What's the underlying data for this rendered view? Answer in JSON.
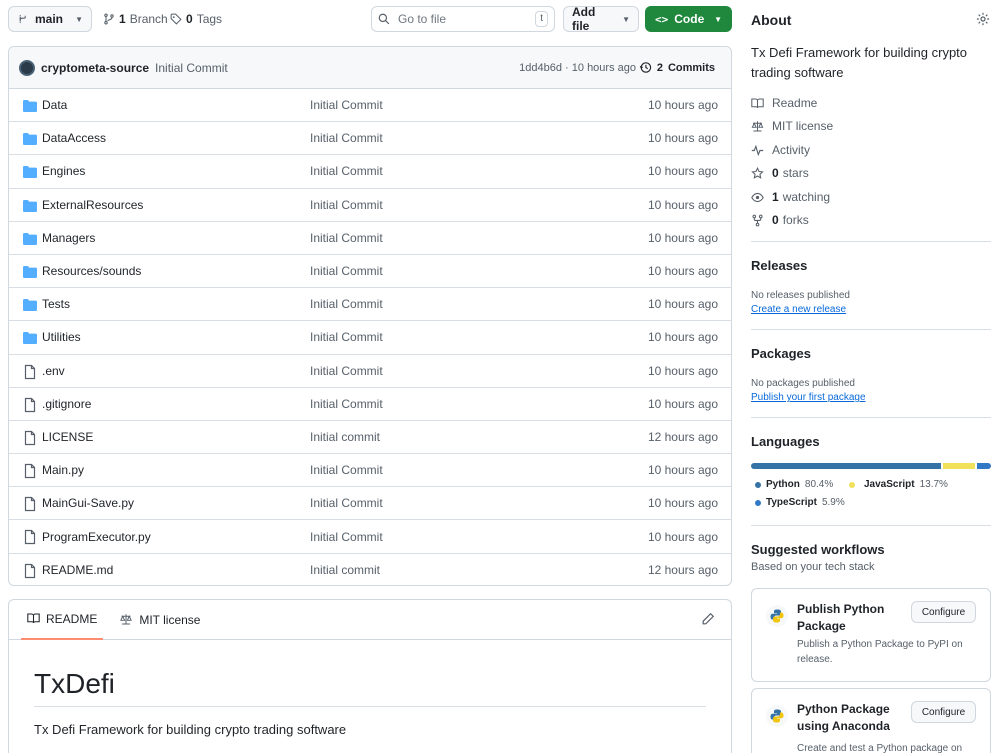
{
  "toolbar": {
    "branch": "main",
    "branches_count": "1",
    "branches_label": "Branch",
    "tags_count": "0",
    "tags_label": "Tags",
    "goto_placeholder": "Go to file",
    "goto_shortcut": "t",
    "add_file_label": "Add file",
    "code_label": "Code"
  },
  "commit": {
    "author": "cryptometa-source",
    "message": "Initial Commit",
    "hash_age": "1dd4b6d · 10 hours ago",
    "commits_count": "2",
    "commits_label": "Commits"
  },
  "files": [
    {
      "type": "dir",
      "name": "Data",
      "message": "Initial Commit",
      "age": "10 hours ago"
    },
    {
      "type": "dir",
      "name": "DataAccess",
      "message": "Initial Commit",
      "age": "10 hours ago"
    },
    {
      "type": "dir",
      "name": "Engines",
      "message": "Initial Commit",
      "age": "10 hours ago"
    },
    {
      "type": "dir",
      "name": "ExternalResources",
      "message": "Initial Commit",
      "age": "10 hours ago"
    },
    {
      "type": "dir",
      "name": "Managers",
      "message": "Initial Commit",
      "age": "10 hours ago"
    },
    {
      "type": "dir",
      "name": "Resources/sounds",
      "message": "Initial Commit",
      "age": "10 hours ago"
    },
    {
      "type": "dir",
      "name": "Tests",
      "message": "Initial Commit",
      "age": "10 hours ago"
    },
    {
      "type": "dir",
      "name": "Utilities",
      "message": "Initial Commit",
      "age": "10 hours ago"
    },
    {
      "type": "file",
      "name": ".env",
      "message": "Initial Commit",
      "age": "10 hours ago"
    },
    {
      "type": "file",
      "name": ".gitignore",
      "message": "Initial Commit",
      "age": "10 hours ago"
    },
    {
      "type": "file",
      "name": "LICENSE",
      "message": "Initial commit",
      "age": "12 hours ago"
    },
    {
      "type": "file",
      "name": "Main.py",
      "message": "Initial Commit",
      "age": "10 hours ago"
    },
    {
      "type": "file",
      "name": "MainGui-Save.py",
      "message": "Initial Commit",
      "age": "10 hours ago"
    },
    {
      "type": "file",
      "name": "ProgramExecutor.py",
      "message": "Initial Commit",
      "age": "10 hours ago"
    },
    {
      "type": "file",
      "name": "README.md",
      "message": "Initial commit",
      "age": "12 hours ago"
    }
  ],
  "readme": {
    "tab_readme": "README",
    "tab_license": "MIT license",
    "title": "TxDefi",
    "description": "Tx Defi Framework for building crypto trading software"
  },
  "about": {
    "heading": "About",
    "description": "Tx Defi Framework for building crypto trading software",
    "readme": "Readme",
    "license": "MIT license",
    "activity": "Activity",
    "stars_count": "0",
    "stars_label": "stars",
    "watching_count": "1",
    "watching_label": "watching",
    "forks_count": "0",
    "forks_label": "forks"
  },
  "releases": {
    "heading": "Releases",
    "none": "No releases published",
    "create_link": "Create a new release"
  },
  "packages": {
    "heading": "Packages",
    "none": "No packages published",
    "publish_link": "Publish your first package"
  },
  "languages": {
    "heading": "Languages",
    "items": [
      {
        "name": "Python",
        "percent": "80.4%",
        "value": 80.4,
        "color": "#3572A5"
      },
      {
        "name": "JavaScript",
        "percent": "13.7%",
        "value": 13.7,
        "color": "#f1e05a"
      },
      {
        "name": "TypeScript",
        "percent": "5.9%",
        "value": 5.9,
        "color": "#3178c6"
      }
    ]
  },
  "workflows": {
    "heading": "Suggested workflows",
    "subheading": "Based on your tech stack",
    "items": [
      {
        "title": "Publish Python Package",
        "description": "Publish a Python Package to PyPI on release.",
        "button": "Configure"
      },
      {
        "title": "Python Package using Anaconda",
        "description": "Create and test a Python package on",
        "button": "Configure"
      }
    ]
  }
}
